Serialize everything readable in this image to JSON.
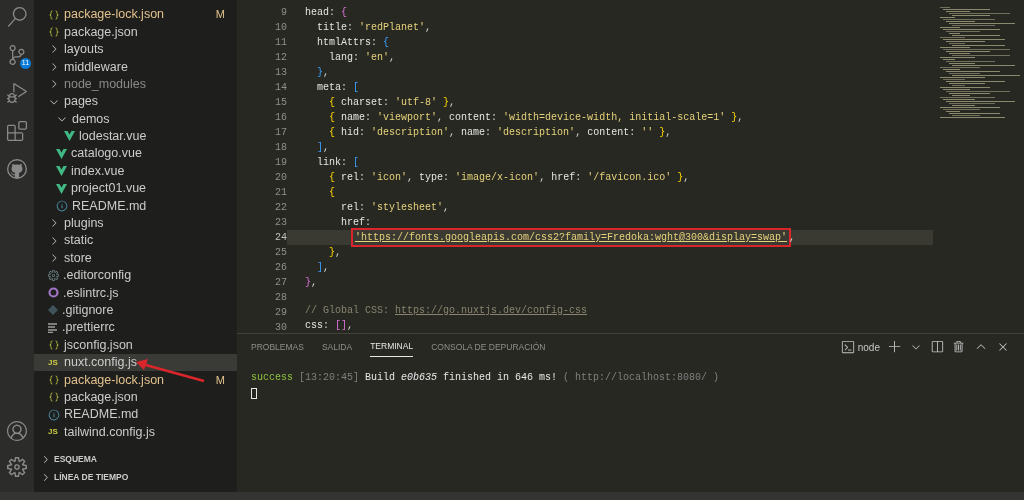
{
  "activity_bar": {
    "items": [
      {
        "kind": "search",
        "selected": false
      },
      {
        "kind": "source-control",
        "selected": false,
        "badge": "11"
      },
      {
        "kind": "debug",
        "selected": false
      },
      {
        "kind": "extensions",
        "selected": false
      },
      {
        "kind": "github",
        "selected": false
      }
    ],
    "bottom_items": [
      {
        "kind": "account"
      },
      {
        "kind": "settings"
      }
    ]
  },
  "explorer": {
    "tree": [
      {
        "kind": "json",
        "name": "package-lock.json",
        "badge": "M",
        "selected": false
      },
      {
        "kind": "json",
        "name": "package.json",
        "selected": false
      },
      {
        "kind": "folder",
        "name": "layouts",
        "expanded": false,
        "selected": false
      },
      {
        "kind": "folder",
        "name": "middleware",
        "expanded": false,
        "selected": false
      },
      {
        "kind": "folder",
        "name": "node_modules",
        "expanded": false,
        "ignored": true,
        "selected": false
      },
      {
        "kind": "folder",
        "name": "pages",
        "expanded": true,
        "selected": false,
        "children": [
          {
            "kind": "folder",
            "name": "demos",
            "expanded": true,
            "selected": false,
            "children": [
              {
                "kind": "vue",
                "name": "lodestar.vue",
                "selected": false
              }
            ]
          },
          {
            "kind": "vue",
            "name": "catalogo.vue",
            "selected": false
          },
          {
            "kind": "vue",
            "name": "index.vue",
            "selected": false
          },
          {
            "kind": "vue",
            "name": "project01.vue",
            "selected": false
          },
          {
            "kind": "info",
            "name": "README.md",
            "selected": false
          }
        ]
      },
      {
        "kind": "folder",
        "name": "plugins",
        "expanded": false,
        "selected": false
      },
      {
        "kind": "folder",
        "name": "static",
        "expanded": false,
        "selected": false
      },
      {
        "kind": "folder",
        "name": "store",
        "expanded": false,
        "selected": false
      },
      {
        "kind": "gear",
        "name": ".editorconfig",
        "selected": false
      },
      {
        "kind": "eslint",
        "name": ".eslintrc.js",
        "selected": false
      },
      {
        "kind": "git",
        "name": ".gitignore",
        "selected": false
      },
      {
        "kind": "lines",
        "name": ".prettierrc",
        "selected": false
      },
      {
        "kind": "json",
        "name": "jsconfig.json",
        "selected": false
      },
      {
        "kind": "js",
        "icon_label": "JS",
        "name": "nuxt.config.js",
        "selected": true
      },
      {
        "kind": "json",
        "name": "package-lock.json",
        "badge": "M",
        "selected": false
      },
      {
        "kind": "json",
        "name": "package.json",
        "selected": false
      },
      {
        "kind": "info",
        "name": "README.md",
        "selected": false
      },
      {
        "kind": "js",
        "icon_label": "JS",
        "name": "tailwind.config.js",
        "selected": false
      }
    ],
    "sections": [
      {
        "title": "ESQUEMA",
        "expanded": false
      },
      {
        "title": "LÍNEA DE TIEMPO",
        "expanded": false
      }
    ]
  },
  "editor": {
    "lines": [
      {
        "number": "9",
        "tokens": [
          {
            "text": "  head",
            "kind": "key"
          },
          {
            "text": ": ",
            "kind": "punct"
          },
          {
            "text": "{",
            "kind": "bracket-purple"
          }
        ]
      },
      {
        "number": "10",
        "tokens": [
          {
            "text": "    title",
            "kind": "key"
          },
          {
            "text": ": ",
            "kind": "punct"
          },
          {
            "text": "'redPlanet'",
            "kind": "string"
          },
          {
            "text": ",",
            "kind": "punct"
          }
        ]
      },
      {
        "number": "11",
        "tokens": [
          {
            "text": "    htmlAttrs",
            "kind": "key"
          },
          {
            "text": ": ",
            "kind": "punct"
          },
          {
            "text": "{",
            "kind": "bracket-blue"
          }
        ]
      },
      {
        "number": "12",
        "tokens": [
          {
            "text": "      lang",
            "kind": "key"
          },
          {
            "text": ": ",
            "kind": "punct"
          },
          {
            "text": "'en'",
            "kind": "string"
          },
          {
            "text": ",",
            "kind": "punct"
          }
        ]
      },
      {
        "number": "13",
        "tokens": [
          {
            "text": "    }",
            "kind": "bracket-blue"
          },
          {
            "text": ",",
            "kind": "punct"
          }
        ]
      },
      {
        "number": "14",
        "tokens": [
          {
            "text": "    meta",
            "kind": "key"
          },
          {
            "text": ": ",
            "kind": "punct"
          },
          {
            "text": "[",
            "kind": "bracket-blue"
          }
        ]
      },
      {
        "number": "15",
        "tokens": [
          {
            "text": "      {",
            "kind": "bracket-gold"
          },
          {
            "text": " charset",
            "kind": "key"
          },
          {
            "text": ": ",
            "kind": "punct"
          },
          {
            "text": "'utf-8'",
            "kind": "string"
          },
          {
            "text": " }",
            "kind": "bracket-gold"
          },
          {
            "text": ",",
            "kind": "punct"
          }
        ]
      },
      {
        "number": "16",
        "tokens": [
          {
            "text": "      {",
            "kind": "bracket-gold"
          },
          {
            "text": " name",
            "kind": "key"
          },
          {
            "text": ": ",
            "kind": "punct"
          },
          {
            "text": "'viewport'",
            "kind": "string"
          },
          {
            "text": ", ",
            "kind": "punct"
          },
          {
            "text": "content",
            "kind": "key"
          },
          {
            "text": ": ",
            "kind": "punct"
          },
          {
            "text": "'width=device-width, initial-scale=1'",
            "kind": "string"
          },
          {
            "text": " }",
            "kind": "bracket-gold"
          },
          {
            "text": ",",
            "kind": "punct"
          }
        ]
      },
      {
        "number": "17",
        "tokens": [
          {
            "text": "      {",
            "kind": "bracket-gold"
          },
          {
            "text": " hid",
            "kind": "key"
          },
          {
            "text": ": ",
            "kind": "punct"
          },
          {
            "text": "'description'",
            "kind": "string"
          },
          {
            "text": ", ",
            "kind": "punct"
          },
          {
            "text": "name",
            "kind": "key"
          },
          {
            "text": ": ",
            "kind": "punct"
          },
          {
            "text": "'description'",
            "kind": "string"
          },
          {
            "text": ", ",
            "kind": "punct"
          },
          {
            "text": "content",
            "kind": "key"
          },
          {
            "text": ": ",
            "kind": "punct"
          },
          {
            "text": "''",
            "kind": "string"
          },
          {
            "text": " }",
            "kind": "bracket-gold"
          },
          {
            "text": ",",
            "kind": "punct"
          }
        ]
      },
      {
        "number": "18",
        "tokens": [
          {
            "text": "    ]",
            "kind": "bracket-blue"
          },
          {
            "text": ",",
            "kind": "punct"
          }
        ]
      },
      {
        "number": "19",
        "tokens": [
          {
            "text": "    link",
            "kind": "key"
          },
          {
            "text": ": ",
            "kind": "punct"
          },
          {
            "text": "[",
            "kind": "bracket-blue"
          }
        ]
      },
      {
        "number": "20",
        "tokens": [
          {
            "text": "      {",
            "kind": "bracket-gold"
          },
          {
            "text": " rel",
            "kind": "key"
          },
          {
            "text": ": ",
            "kind": "punct"
          },
          {
            "text": "'icon'",
            "kind": "string"
          },
          {
            "text": ", ",
            "kind": "punct"
          },
          {
            "text": "type",
            "kind": "key"
          },
          {
            "text": ": ",
            "kind": "punct"
          },
          {
            "text": "'image/x-icon'",
            "kind": "string"
          },
          {
            "text": ", ",
            "kind": "punct"
          },
          {
            "text": "href",
            "kind": "key"
          },
          {
            "text": ": ",
            "kind": "punct"
          },
          {
            "text": "'/favicon.ico'",
            "kind": "string"
          },
          {
            "text": " }",
            "kind": "bracket-gold"
          },
          {
            "text": ",",
            "kind": "punct"
          }
        ]
      },
      {
        "number": "21",
        "tokens": [
          {
            "text": "      {",
            "kind": "bracket-gold"
          }
        ]
      },
      {
        "number": "22",
        "tokens": [
          {
            "text": "        rel",
            "kind": "key"
          },
          {
            "text": ": ",
            "kind": "punct"
          },
          {
            "text": "'stylesheet'",
            "kind": "string"
          },
          {
            "text": ",",
            "kind": "punct"
          }
        ]
      },
      {
        "number": "23",
        "tokens": [
          {
            "text": "        href",
            "kind": "key"
          },
          {
            "text": ":",
            "kind": "punct"
          }
        ]
      },
      {
        "number": "24",
        "current": true,
        "tokens": [
          {
            "text": "'https://fonts.googleapis.com/css2?family=Fredoka:wght@300&display=swap'",
            "kind": "string",
            "boxed": true
          },
          {
            "text": ",",
            "kind": "punct"
          }
        ]
      },
      {
        "number": "25",
        "tokens": [
          {
            "text": "      }",
            "kind": "bracket-gold"
          },
          {
            "text": ",",
            "kind": "punct"
          }
        ]
      },
      {
        "number": "26",
        "tokens": [
          {
            "text": "    ]",
            "kind": "bracket-blue"
          },
          {
            "text": ",",
            "kind": "punct"
          }
        ]
      },
      {
        "number": "27",
        "tokens": [
          {
            "text": "  }",
            "kind": "bracket-purple"
          },
          {
            "text": ",",
            "kind": "punct"
          }
        ]
      },
      {
        "number": "28"
      },
      {
        "number": "29",
        "tokens": [
          {
            "text": "  // Global CSS: ",
            "kind": "comment"
          },
          {
            "text": "https://go.nuxtjs.dev/config-css",
            "kind": "comment-link"
          }
        ]
      },
      {
        "number": "30",
        "tokens": [
          {
            "text": "  css",
            "kind": "key"
          },
          {
            "text": ": ",
            "kind": "punct"
          },
          {
            "text": "[]",
            "kind": "bracket-purple"
          },
          {
            "text": ",",
            "kind": "punct"
          }
        ]
      }
    ]
  },
  "panel": {
    "tabs": [
      {
        "label": "PROBLEMAS",
        "selected": false
      },
      {
        "label": "SALIDA",
        "selected": false
      },
      {
        "label": "TERMINAL",
        "selected": true
      },
      {
        "label": "CONSOLA DE DEPURACIÓN",
        "selected": false
      }
    ],
    "terminal_profile": "node",
    "terminal_output": [
      {
        "text": "success",
        "kind": "ok"
      },
      {
        "text": " [13:20:45]",
        "kind": "dim"
      },
      {
        "text": " Build ",
        "kind": "plain"
      },
      {
        "text": "e0b635",
        "kind": "italic"
      },
      {
        "text": " finished in 646 ms!",
        "kind": "plain"
      },
      {
        "text": " ( http://localhost:8080/ )",
        "kind": "dim"
      }
    ]
  }
}
